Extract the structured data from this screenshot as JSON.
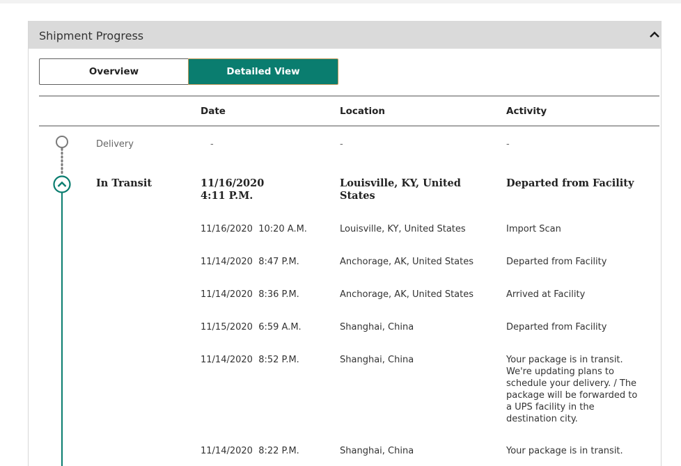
{
  "panel": {
    "title": "Shipment Progress"
  },
  "view_toggle": {
    "overview_label": "Overview",
    "detailed_label": "Detailed View",
    "selected": "Detailed View"
  },
  "table": {
    "headers": {
      "date": "Date",
      "location": "Location",
      "activity": "Activity"
    },
    "milestones": [
      {
        "status": "Delivery",
        "date": "-",
        "location": "-",
        "activity": "-"
      },
      {
        "status": "In Transit",
        "date_line1": "11/16/2020",
        "date_line2": "4:11 P.M.",
        "location": "Louisville, KY, United States",
        "activity": "Departed from Facility"
      }
    ],
    "events": [
      {
        "date": "11/16/2020  10:20 A.M.",
        "location": "Louisville, KY, United States",
        "activity": "Import Scan"
      },
      {
        "date": "11/14/2020  8:47 P.M.",
        "location": "Anchorage, AK, United States",
        "activity": "Departed from Facility"
      },
      {
        "date": "11/14/2020  8:36 P.M.",
        "location": "Anchorage, AK, United States",
        "activity": "Arrived at Facility"
      },
      {
        "date": "11/15/2020  6:59 A.M.",
        "location": "Shanghai, China",
        "activity": "Departed from Facility"
      },
      {
        "date": "11/14/2020  8:52 P.M.",
        "location": "Shanghai, China",
        "activity": "Your package is in transit. We're updating plans to schedule your delivery. / The package will be forwarded to a UPS facility in the destination city."
      },
      {
        "date": "11/14/2020  8:22 P.M.",
        "location": "Shanghai, China",
        "activity": "Your package is in transit."
      }
    ]
  },
  "colors": {
    "accent": "#0a7d6f",
    "header_bg": "#dadada",
    "pending_circle": "#7a7a7a"
  },
  "icons": {
    "collapse": "chevron-up-icon",
    "pending_step": "empty-circle-icon",
    "current_step": "chevron-up-circle-icon"
  }
}
